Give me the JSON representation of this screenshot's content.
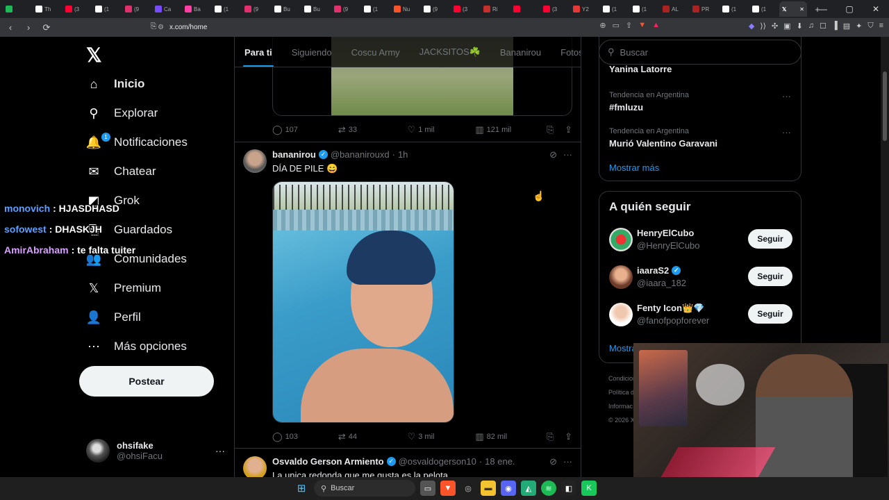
{
  "browser": {
    "tabs": [
      {
        "label": "",
        "color": "#1db954"
      },
      {
        "label": "Th",
        "color": "#ffffff"
      },
      {
        "label": "(3",
        "color": "#ff0033"
      },
      {
        "label": "(1",
        "color": "#ffffff"
      },
      {
        "label": "(9",
        "color": "#e1306c"
      },
      {
        "label": "Ca",
        "color": "#7a4cff"
      },
      {
        "label": "Ba",
        "color": "#ff3fa4"
      },
      {
        "label": "(1",
        "color": "#ffffff"
      },
      {
        "label": "(9",
        "color": "#e1306c"
      },
      {
        "label": "Bu",
        "color": "#ffffff"
      },
      {
        "label": "Bu",
        "color": "#ffffff"
      },
      {
        "label": "(9",
        "color": "#e1306c"
      },
      {
        "label": "(1",
        "color": "#ffffff"
      },
      {
        "label": "Nu",
        "color": "#fb542b"
      },
      {
        "label": "(9",
        "color": "#ffffff"
      },
      {
        "label": "(3",
        "color": "#ff0033"
      },
      {
        "label": "Ri",
        "color": "#c4302b"
      },
      {
        "label": "",
        "color": "#ff0033"
      },
      {
        "label": "(3",
        "color": "#ff0033"
      },
      {
        "label": "Y2",
        "color": "#e53935"
      },
      {
        "label": "(1",
        "color": "#ffffff"
      },
      {
        "label": "(1",
        "color": "#ffffff"
      },
      {
        "label": "AL",
        "color": "#aa2222"
      },
      {
        "label": "PR",
        "color": "#aa2222"
      },
      {
        "label": "(1",
        "color": "#ffffff"
      },
      {
        "label": "(1",
        "color": "#ffffff"
      }
    ],
    "url": "x.com/home"
  },
  "leftnav": {
    "logo": "𝕏",
    "items": [
      {
        "label": "Inicio",
        "icon": "home-icon",
        "glyph": "⌂"
      },
      {
        "label": "Explorar",
        "icon": "search-icon",
        "glyph": "⚲"
      },
      {
        "label": "Notificaciones",
        "icon": "bell-icon",
        "glyph": "🔔",
        "badge": "1"
      },
      {
        "label": "Chatear",
        "icon": "mail-icon",
        "glyph": "✉"
      },
      {
        "label": "Grok",
        "icon": "grok-icon",
        "glyph": "◩"
      },
      {
        "label": "Guardados",
        "icon": "bookmark-icon",
        "glyph": "⎘"
      },
      {
        "label": "Comunidades",
        "icon": "people-icon",
        "glyph": "👥"
      },
      {
        "label": "Premium",
        "icon": "x-premium-icon",
        "glyph": "𝕏"
      },
      {
        "label": "Perfil",
        "icon": "person-icon",
        "glyph": "👤"
      },
      {
        "label": "Más opciones",
        "icon": "more-circle-icon",
        "glyph": "⋯"
      }
    ],
    "post_button": "Postear",
    "account": {
      "name": "ohsifake",
      "handle": "@ohsiFacu"
    }
  },
  "chat": [
    {
      "user": "monovich",
      "color": "#5aa0ff",
      "message": ": HJASDHASD"
    },
    {
      "user": "sofowest",
      "color": "#5aa0ff",
      "message": ": DHASKJH"
    },
    {
      "user": "AmirAbraham",
      "color": "#d9a0ff",
      "message": ": te falta tuiter"
    }
  ],
  "main": {
    "tabs": [
      "Para ti",
      "Siguiendo",
      "Coscu Army",
      "JACKSITOS☘️",
      "Bananirou",
      "Fotos d"
    ],
    "tweet1_actions": {
      "replies": "107",
      "retweets": "33",
      "likes": "1 mil",
      "views": "121 mil"
    },
    "tweet2": {
      "name": "bananirou",
      "handle": "@bananirouxd",
      "time": "1h",
      "text": "DÍA DE PILE 😄",
      "actions": {
        "replies": "103",
        "retweets": "44",
        "likes": "3 mil",
        "views": "82 mil"
      }
    },
    "tweet3": {
      "name": "Osvaldo Gerson Armiento",
      "handle": "@osvaldogerson10",
      "time": "18 ene.",
      "text": "La unica redonda que me gusta es la pelota"
    }
  },
  "right": {
    "search_placeholder": "Buscar",
    "trends_partial": "Yanina Latorre",
    "trends": [
      {
        "context": "Tendencia en Argentina",
        "title": "#fmluzu"
      },
      {
        "context": "Tendencia en Argentina",
        "title": "Murió Valentino Garavani"
      }
    ],
    "show_more": "Mostrar más",
    "who_to_follow": {
      "title": "A quién seguir",
      "items": [
        {
          "name": "HenryElCubo",
          "handle": "@HenryElCubo",
          "button": "Seguir",
          "verified": false
        },
        {
          "name": "iaaraS2",
          "handle": "@iaara_182",
          "button": "Seguir",
          "verified": true
        },
        {
          "name": "Fenty Icon👑💎",
          "handle": "@fanofpopforever",
          "button": "Seguir",
          "verified": false
        }
      ],
      "show_more": "Mostrar más"
    },
    "footer": [
      "Condiciones",
      "Política d",
      "Informac",
      "© 2026 X"
    ]
  },
  "taskbar": {
    "search": "Buscar"
  }
}
